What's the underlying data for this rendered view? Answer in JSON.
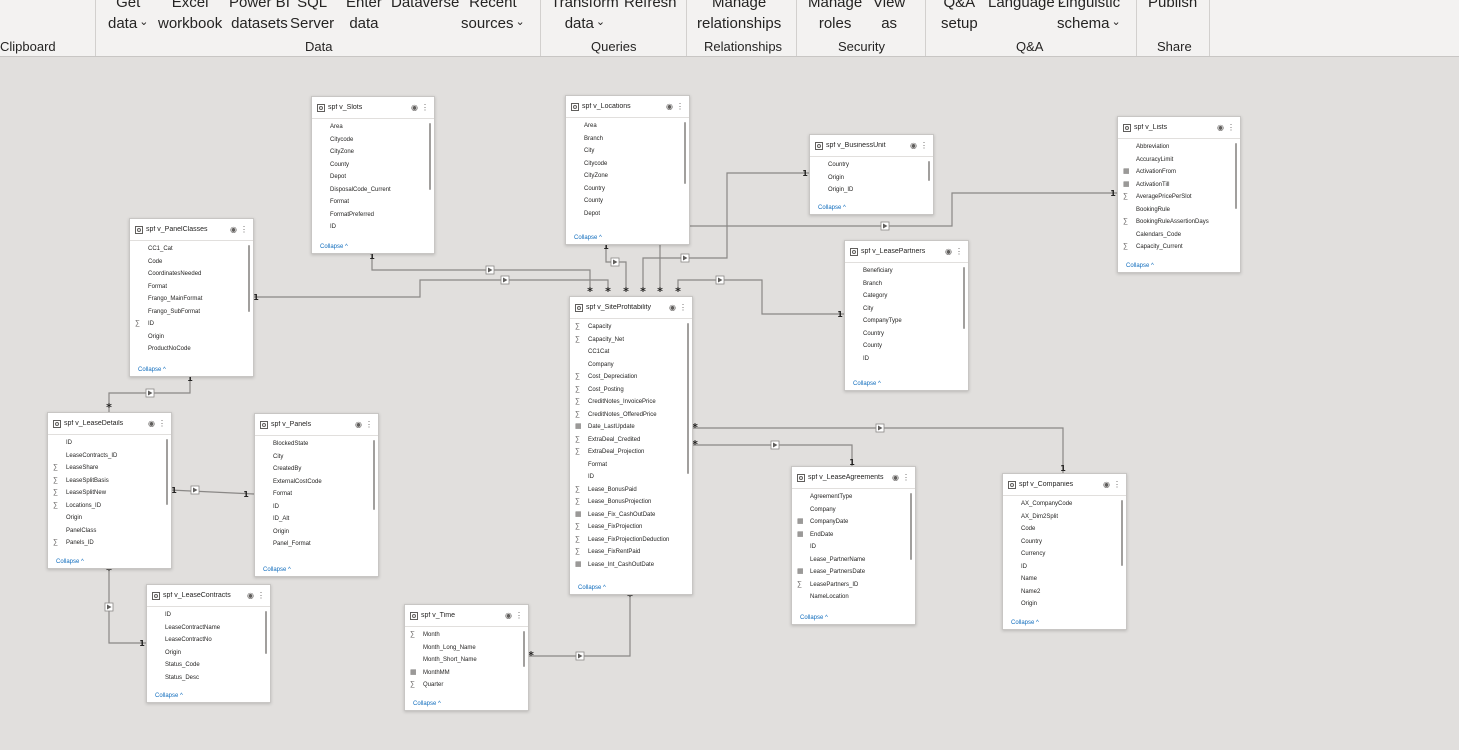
{
  "ribbon": {
    "buttons": [
      {
        "id": "get-data",
        "l1": "Get",
        "l2": "data",
        "caret": true
      },
      {
        "id": "excel-workbook",
        "l1": "Excel",
        "l2": "workbook"
      },
      {
        "id": "power-bi-datasets",
        "l1": "Power BI",
        "l2": "datasets"
      },
      {
        "id": "sql-server",
        "l1": "SQL",
        "l2": "Server"
      },
      {
        "id": "enter-data",
        "l1": "Enter",
        "l2": "data"
      },
      {
        "id": "dataverse",
        "l1": "Dataverse",
        "l2": ""
      },
      {
        "id": "recent-sources",
        "l1": "Recent",
        "l2": "sources",
        "caret": true
      },
      {
        "id": "transform-data",
        "l1": "Transform",
        "l2": "data",
        "caret": true
      },
      {
        "id": "refresh",
        "l1": "Refresh",
        "l2": ""
      },
      {
        "id": "manage-relationships",
        "l1": "Manage",
        "l2": "relationships"
      },
      {
        "id": "manage-roles",
        "l1": "Manage",
        "l2": "roles"
      },
      {
        "id": "view-as",
        "l1": "View",
        "l2": "as"
      },
      {
        "id": "qa-setup",
        "l1": "Q&A",
        "l2": "setup"
      },
      {
        "id": "language",
        "l1": "Language",
        "l2": "",
        "caret": true
      },
      {
        "id": "linguistic-schema",
        "l1": "Linguistic",
        "l2": "schema",
        "caret": true
      },
      {
        "id": "publish",
        "l1": "Publish",
        "l2": ""
      }
    ],
    "groups": {
      "clipboard": "Clipboard",
      "data": "Data",
      "queries": "Queries",
      "relationships": "Relationships",
      "security": "Security",
      "qa": "Q&A",
      "share": "Share"
    },
    "caret_glyph": "⌄"
  },
  "card_common": {
    "collapse_label": "Collapse ^",
    "eye_glyph": "◉",
    "more_glyph": "⋮"
  },
  "tables": [
    {
      "id": "slots",
      "name": "spf v_Slots",
      "fields": [
        {
          "n": "Area"
        },
        {
          "n": "Citycode"
        },
        {
          "n": "CityZone"
        },
        {
          "n": "County"
        },
        {
          "n": "Depot"
        },
        {
          "n": "DisposalCode_Current"
        },
        {
          "n": "Format"
        },
        {
          "n": "FormatPreferred"
        },
        {
          "n": "ID"
        }
      ]
    },
    {
      "id": "locations",
      "name": "spf v_Locations",
      "fields": [
        {
          "n": "Area"
        },
        {
          "n": "Branch"
        },
        {
          "n": "City"
        },
        {
          "n": "Citycode"
        },
        {
          "n": "CityZone"
        },
        {
          "n": "Country"
        },
        {
          "n": "County"
        },
        {
          "n": "Depot"
        }
      ]
    },
    {
      "id": "businessunit",
      "name": "spf v_BusinessUnit",
      "fields": [
        {
          "n": "Country"
        },
        {
          "n": "Origin"
        },
        {
          "n": "Origin_ID"
        }
      ]
    },
    {
      "id": "lists",
      "name": "spf v_Lists",
      "fields": [
        {
          "n": "Abbreviation"
        },
        {
          "n": "AccuracyLimit"
        },
        {
          "n": "ActivationFrom",
          "t": "cal"
        },
        {
          "n": "ActivationTill",
          "t": "cal"
        },
        {
          "n": "AveragePricePerSlot",
          "t": "sum"
        },
        {
          "n": "BookingRule"
        },
        {
          "n": "BookingRuleAssertionDays",
          "t": "sum"
        },
        {
          "n": "Calendars_Code"
        },
        {
          "n": "Capacity_Current",
          "t": "sum"
        }
      ]
    },
    {
      "id": "panelclasses",
      "name": "spf v_PanelClasses",
      "fields": [
        {
          "n": "CC1_Cat"
        },
        {
          "n": "Code"
        },
        {
          "n": "CoordinatesNeeded"
        },
        {
          "n": "Format"
        },
        {
          "n": "Frango_MainFormat"
        },
        {
          "n": "Frango_SubFormat"
        },
        {
          "n": "ID",
          "t": "sum"
        },
        {
          "n": "Origin"
        },
        {
          "n": "ProductNoCode"
        }
      ]
    },
    {
      "id": "leasepartners",
      "name": "spf v_LeasePartners",
      "fields": [
        {
          "n": "Beneficiary"
        },
        {
          "n": "Branch"
        },
        {
          "n": "Category"
        },
        {
          "n": "City"
        },
        {
          "n": "CompanyType"
        },
        {
          "n": "Country"
        },
        {
          "n": "County"
        },
        {
          "n": "ID"
        }
      ]
    },
    {
      "id": "siteprofitability",
      "name": "spf v_SiteProfitability",
      "fields": [
        {
          "n": "Capacity",
          "t": "sum"
        },
        {
          "n": "Capacity_Net",
          "t": "sum"
        },
        {
          "n": "CC1Cat"
        },
        {
          "n": "Company"
        },
        {
          "n": "Cost_Depreciation",
          "t": "sum"
        },
        {
          "n": "Cost_Posting",
          "t": "sum"
        },
        {
          "n": "CreditNotes_InvoicePrice",
          "t": "sum"
        },
        {
          "n": "CreditNotes_OfferedPrice",
          "t": "sum"
        },
        {
          "n": "Date_LastUpdate",
          "t": "cal"
        },
        {
          "n": "ExtraDeal_Credited",
          "t": "sum"
        },
        {
          "n": "ExtraDeal_Projection",
          "t": "sum"
        },
        {
          "n": "Format"
        },
        {
          "n": "ID"
        },
        {
          "n": "Lease_BonusPaid",
          "t": "sum"
        },
        {
          "n": "Lease_BonusProjection",
          "t": "sum"
        },
        {
          "n": "Lease_Fix_CashOutDate",
          "t": "cal"
        },
        {
          "n": "Lease_FixProjection",
          "t": "sum"
        },
        {
          "n": "Lease_FixProjectionDeduction",
          "t": "sum"
        },
        {
          "n": "Lease_FixRentPaid",
          "t": "sum"
        },
        {
          "n": "Lease_Int_CashOutDate",
          "t": "cal"
        }
      ]
    },
    {
      "id": "leasedetails",
      "name": "spf v_LeaseDetails",
      "fields": [
        {
          "n": "ID"
        },
        {
          "n": "LeaseContracts_ID"
        },
        {
          "n": "LeaseShare",
          "t": "sum"
        },
        {
          "n": "LeaseSplitBasis",
          "t": "sum"
        },
        {
          "n": "LeaseSplitNew",
          "t": "sum"
        },
        {
          "n": "Locations_ID",
          "t": "sum"
        },
        {
          "n": "Origin"
        },
        {
          "n": "PanelClass"
        },
        {
          "n": "Panels_ID",
          "t": "sum"
        }
      ]
    },
    {
      "id": "panels",
      "name": "spf v_Panels",
      "fields": [
        {
          "n": "BlockedState"
        },
        {
          "n": "City"
        },
        {
          "n": "CreatedBy"
        },
        {
          "n": "ExternalCostCode"
        },
        {
          "n": "Format"
        },
        {
          "n": "ID"
        },
        {
          "n": "ID_Alt"
        },
        {
          "n": "Origin"
        },
        {
          "n": "Panel_Format"
        }
      ]
    },
    {
      "id": "leaseagreements",
      "name": "spf v_LeaseAgreements",
      "fields": [
        {
          "n": "AgreementType"
        },
        {
          "n": "Company"
        },
        {
          "n": "CompanyDate",
          "t": "cal"
        },
        {
          "n": "EndDate",
          "t": "cal"
        },
        {
          "n": "ID"
        },
        {
          "n": "Lease_PartnerName"
        },
        {
          "n": "Lease_PartnersDate",
          "t": "cal"
        },
        {
          "n": "LeasePartners_ID",
          "t": "sum"
        },
        {
          "n": "NameLocation"
        }
      ]
    },
    {
      "id": "companies",
      "name": "spf v_Companies",
      "fields": [
        {
          "n": "AX_CompanyCode"
        },
        {
          "n": "AX_Dim2Split"
        },
        {
          "n": "Code"
        },
        {
          "n": "Country"
        },
        {
          "n": "Currency"
        },
        {
          "n": "ID"
        },
        {
          "n": "Name"
        },
        {
          "n": "Name2"
        },
        {
          "n": "Origin"
        }
      ]
    },
    {
      "id": "leasecontracts",
      "name": "spf v_LeaseContracts",
      "fields": [
        {
          "n": "ID"
        },
        {
          "n": "LeaseContractName"
        },
        {
          "n": "LeaseContractNo"
        },
        {
          "n": "Origin"
        },
        {
          "n": "Status_Code"
        },
        {
          "n": "Status_Desc"
        }
      ]
    },
    {
      "id": "time",
      "name": "spf v_Time",
      "fields": [
        {
          "n": "Month",
          "t": "sum"
        },
        {
          "n": "Month_Long_Name"
        },
        {
          "n": "Month_Short_Name"
        },
        {
          "n": "MonthMM",
          "t": "cal"
        },
        {
          "n": "Quarter",
          "t": "sum"
        }
      ]
    }
  ],
  "relationships": [
    {
      "from": "slots",
      "to": "siteprofitability",
      "from_card": "1",
      "to_card": "*"
    },
    {
      "from": "locations",
      "to": "siteprofitability",
      "from_card": "1",
      "to_card": "*"
    },
    {
      "from": "panelclasses",
      "to": "siteprofitability",
      "from_card": "1",
      "to_card": "*"
    },
    {
      "from": "businessunit",
      "to": "siteprofitability",
      "from_card": "1",
      "to_card": "*"
    },
    {
      "from": "lists",
      "to": "siteprofitability",
      "from_card": "1",
      "to_card": "*"
    },
    {
      "from": "leasepartners",
      "to": "siteprofitability",
      "from_card": "1",
      "to_card": "*"
    },
    {
      "from": "panelclasses",
      "to": "leasedetails",
      "from_card": "1",
      "to_card": "*"
    },
    {
      "from": "leasedetails",
      "to": "panels",
      "from_card": "1",
      "to_card": "1"
    },
    {
      "from": "leasecontracts",
      "to": "leasedetails",
      "from_card": "1",
      "to_card": "*"
    },
    {
      "from": "companies",
      "to": "siteprofitability",
      "from_card": "1",
      "to_card": "*"
    },
    {
      "from": "leaseagreements",
      "to": "siteprofitability",
      "from_card": "1",
      "to_card": "*"
    },
    {
      "from": "time",
      "to": "siteprofitability",
      "from_card": "*",
      "to_card": "*"
    }
  ]
}
